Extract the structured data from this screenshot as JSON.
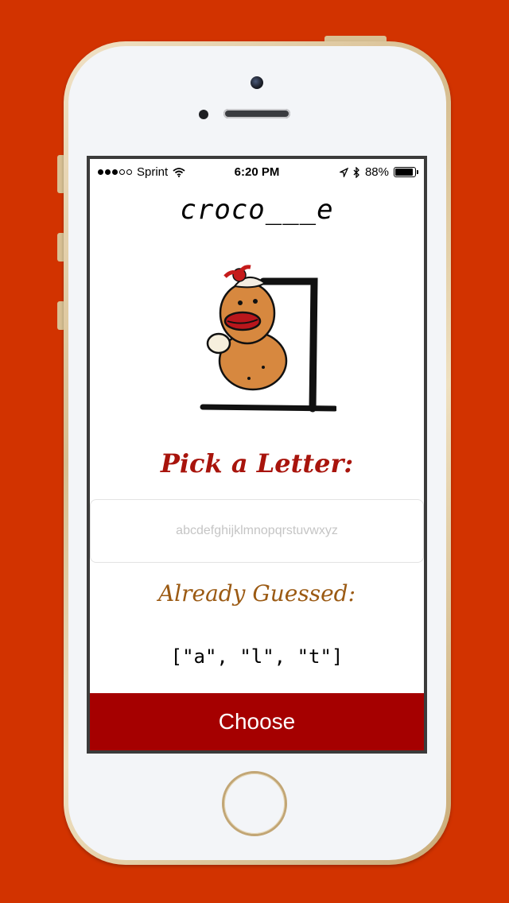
{
  "status_bar": {
    "carrier": "Sprint",
    "time": "6:20 PM",
    "battery": "88%",
    "signal_bars_filled": 3,
    "signal_bars_total": 5,
    "battery_level": 0.88
  },
  "game": {
    "word_display": "croco___e",
    "pick_title": "Pick a Letter:",
    "input_placeholder": "abcdefghijklmnopqrstuvwxyz",
    "input_value": "",
    "guessed_title": "Already Guessed:",
    "guessed_letters": "[\"a\", \"l\", \"t\"]",
    "choose_label": "Choose"
  },
  "colors": {
    "background": "#d23300",
    "pick_title": "#a8140c",
    "guessed_title": "#9b5a13",
    "choose_button": "#a50000"
  },
  "icons": {
    "wifi": "wifi-icon",
    "location": "location-arrow-icon",
    "bluetooth": "bluetooth-icon",
    "battery": "battery-icon",
    "hangman": "sock-monkey-hangman-illustration"
  }
}
